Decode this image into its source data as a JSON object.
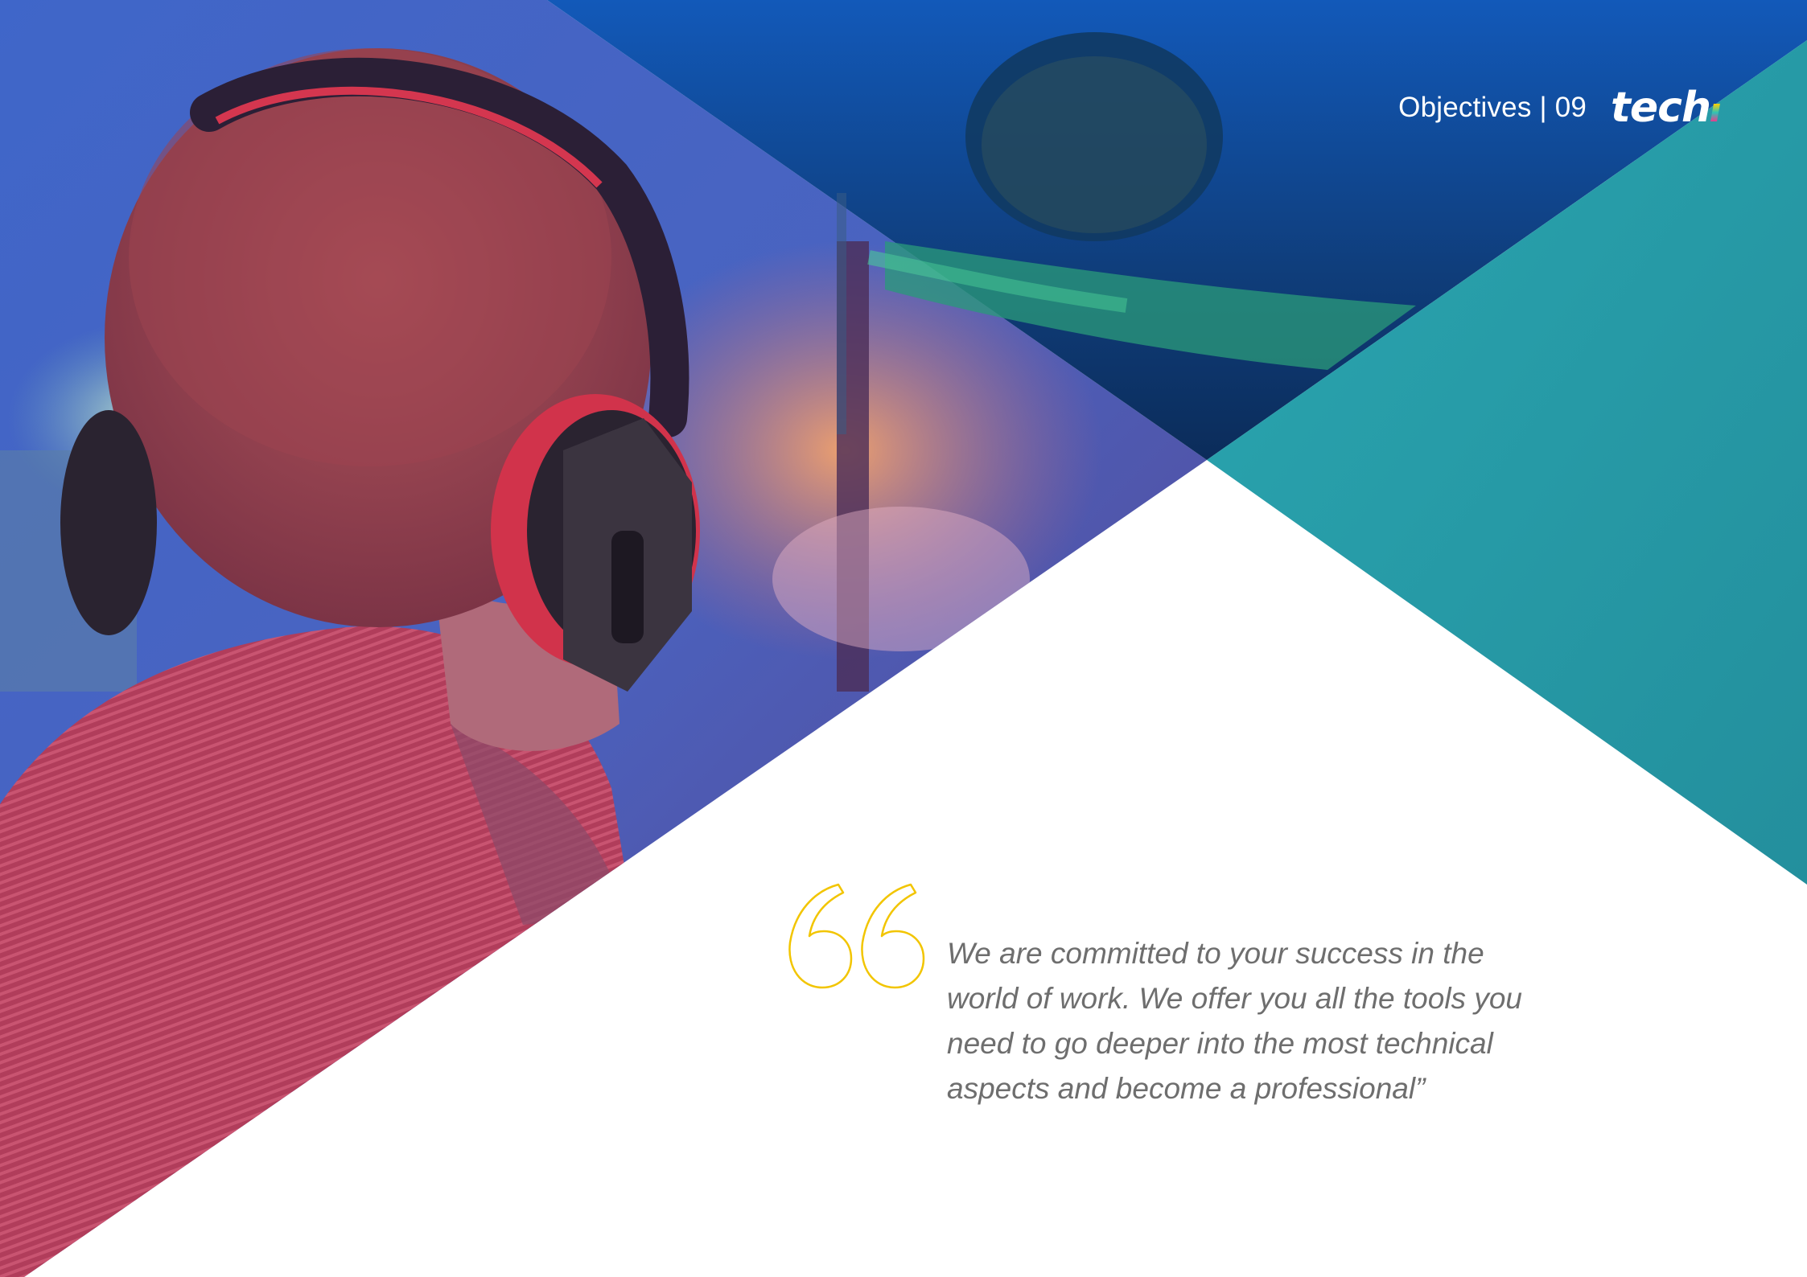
{
  "header": {
    "section_label": "Objectives | 09",
    "logo_text": "tech"
  },
  "quote": {
    "text": "We are committed to your success in the world of work. We offer you all the tools you need to go deeper into the most technical aspects and become a professional”"
  },
  "colors": {
    "teal_panel": "#2aa3ae",
    "quote_mark": "#f2c500",
    "quote_text": "#6e6e6e",
    "header_text": "#ffffff"
  },
  "icons": {
    "quote": "open-quote-icon"
  }
}
